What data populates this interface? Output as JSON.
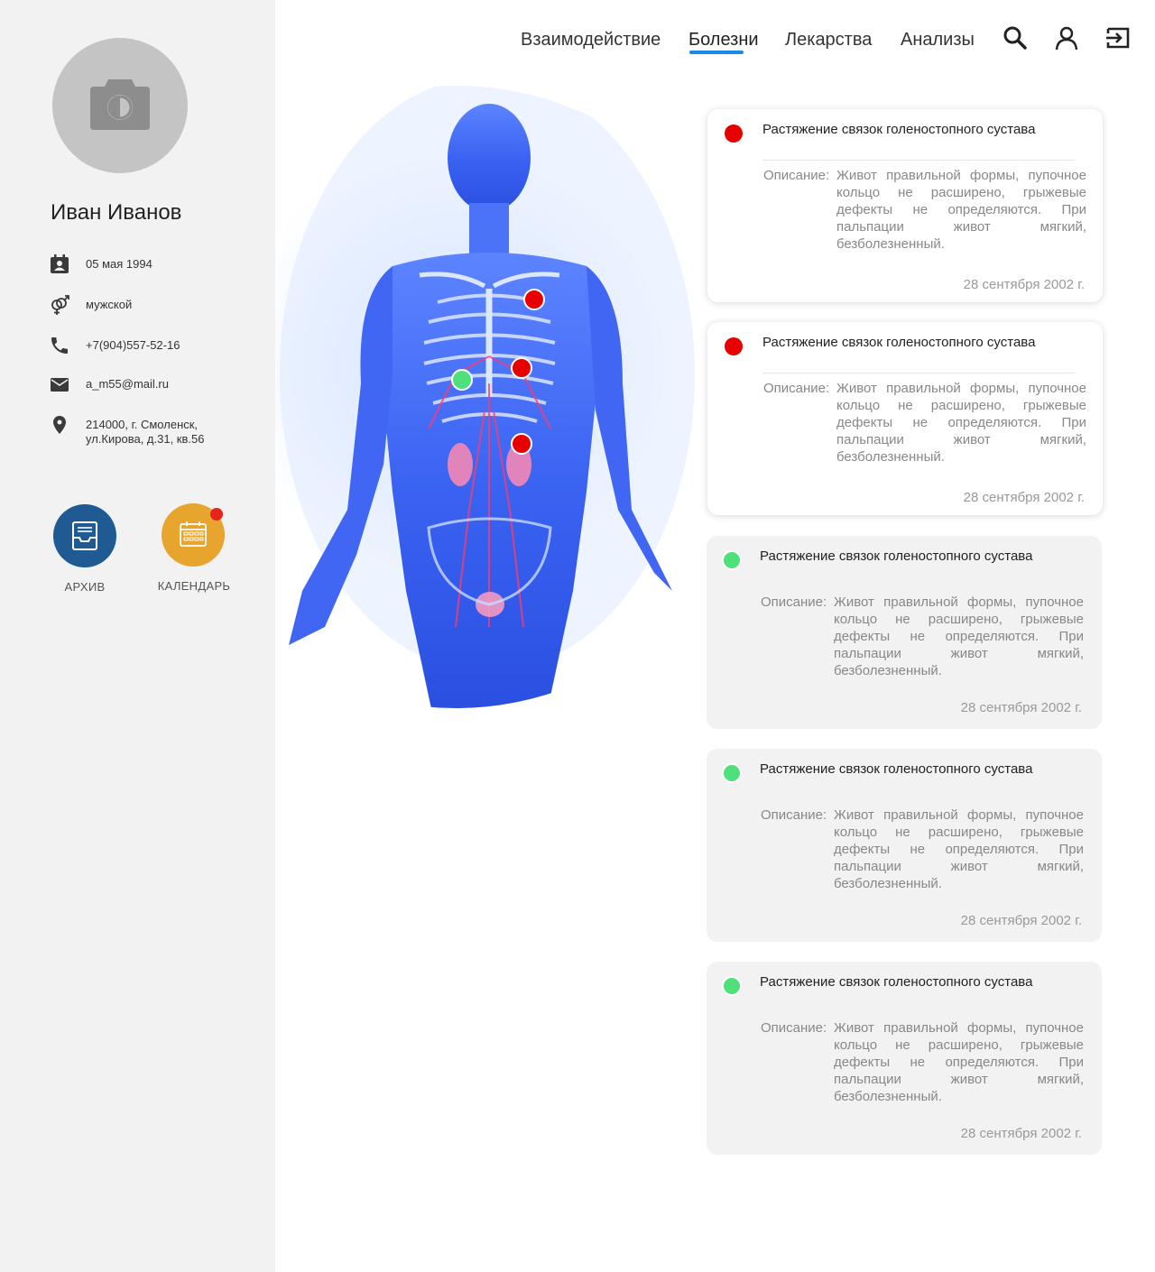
{
  "profile": {
    "name": "Иван Иванов",
    "birth_date": "05 мая 1994",
    "gender": "мужской",
    "phone": "+7(904)557-52-16",
    "email": "a_m55@mail.ru",
    "address": "214000, г. Смоленск,\nул.Кирова, д.31, кв.56"
  },
  "actions": {
    "archive_label": "АРХИВ",
    "calendar_label": "КАЛЕНДАРЬ",
    "archive_color": "#1f5a93",
    "calendar_color": "#e8a52e"
  },
  "nav": {
    "items": [
      "Взаимодействие",
      "Болезни",
      "Лекарства",
      "Анализы"
    ],
    "active": "Болезни",
    "icons": [
      "search-icon",
      "user-icon",
      "logout-icon"
    ]
  },
  "diseases": [
    {
      "status": "red",
      "title": "Растяжение связок голеностопного сустава",
      "desc_label": "Описание:",
      "description": "Живот правильной формы, пупочное кольцо не расширено, грыжевые дефекты не определяются. При пальпации живот мягкий, безболезненный.",
      "date": "28 сентября 2002 г."
    },
    {
      "status": "red",
      "title": "Растяжение связок голеностопного сустава",
      "desc_label": "Описание:",
      "description": "Живот правильной формы, пупочное кольцо не расширено, грыжевые дефекты не определяются. При пальпации живот мягкий, безболезненный.",
      "date": "28 сентября 2002 г."
    },
    {
      "status": "green",
      "title": "Растяжение связок голеностопного сустава",
      "desc_label": "Описание:",
      "description": "Живот правильной формы, пупочное кольцо не расширено, грыжевые дефекты не определяются. При пальпации живот мягкий, безболезненный.",
      "date": "28 сентября 2002 г."
    },
    {
      "status": "green",
      "title": "Растяжение связок голеностопного сустава",
      "desc_label": "Описание:",
      "description": "Живот правильной формы, пупочное кольцо не расширено, грыжевые дефекты не определяются. При пальпации живот мягкий, безболезненный.",
      "date": "28 сентября 2002 г."
    },
    {
      "status": "green",
      "title": "Растяжение связок голеностопного сустава",
      "desc_label": "Описание:",
      "description": "Живот правильной формы, пупочное кольцо не расширено, грыжевые дефекты не определяются. При пальпации живот мягкий, безболезненный.",
      "date": "28 сентября 2002 г."
    }
  ],
  "colors": {
    "red": "#e80000",
    "green": "#4ee07a",
    "accent": "#1e88e5"
  }
}
